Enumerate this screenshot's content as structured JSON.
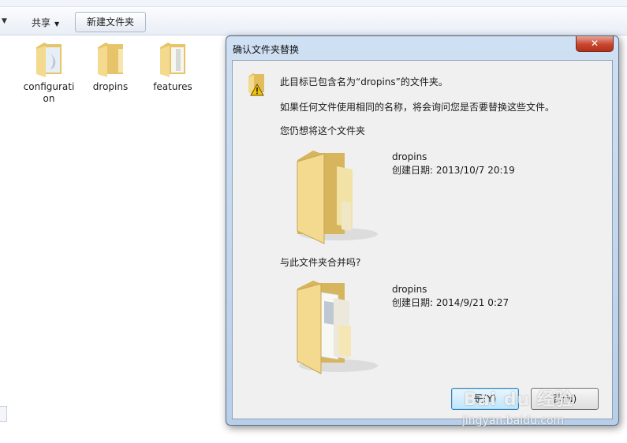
{
  "explorer": {
    "toolbar": {
      "share_label": "共享",
      "new_folder_label": "新建文件夹"
    },
    "files": [
      {
        "name": "configuration",
        "line1": "configurati",
        "line2": "on"
      },
      {
        "name": "dropins",
        "line1": "dropins",
        "line2": ""
      },
      {
        "name": "features",
        "line1": "features",
        "line2": ""
      }
    ]
  },
  "dialog": {
    "title": "确认文件夹替换",
    "close_label": "✕",
    "message": "此目标已包含名为“dropins”的文件夹。",
    "explanation": "如果任何文件使用相同的名称，将会询问您是否要替换这些文件。",
    "question_1": "您仍想将这个文件夹",
    "question_2": "与此文件夹合并吗?",
    "target_folder": {
      "name": "dropins",
      "created": "创建日期: 2013/10/7 20:19"
    },
    "source_folder": {
      "name": "dropins",
      "created": "创建日期: 2014/9/21 0:27"
    },
    "buttons": {
      "yes": "是(Y)",
      "no": "否(N)"
    }
  },
  "watermark": {
    "logo": "Bai du 经验",
    "url": "jingyan.baidu.com"
  },
  "colors": {
    "folder": "#f2d98b",
    "dialog_frame": "#c4d8ef",
    "close_button": "#c8452f"
  },
  "icons": [
    "folder-icon",
    "warning-icon",
    "close-icon",
    "chevron-down-icon"
  ]
}
